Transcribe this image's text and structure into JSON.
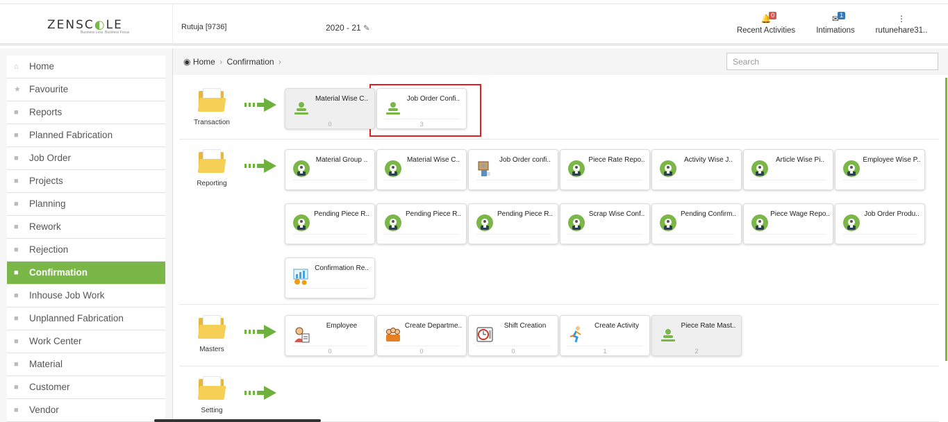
{
  "header": {
    "logo_left": "ZENSC",
    "logo_mid": "◐",
    "logo_right": "LE",
    "tagline": "Business Less. Business Focus",
    "user": "Rutuja [9736]",
    "year": "2020 - 21",
    "edit_icon": "edit-icon",
    "recent": {
      "label": "Recent Activities",
      "icon": "bell-icon",
      "count": "0",
      "color": "#d9534f"
    },
    "intimations": {
      "label": "Intimations",
      "icon": "envelope-icon",
      "count": "1",
      "color": "#337ab7"
    },
    "profile": {
      "label": "rutunehare31..",
      "icon": "more-vertical-icon"
    }
  },
  "sidebar": {
    "active_color": "#7ab648",
    "items": [
      {
        "label": "Home",
        "icon": "home-icon"
      },
      {
        "label": "Favourite",
        "icon": "star-icon"
      },
      {
        "label": "Reports",
        "icon": "file-icon"
      },
      {
        "label": "Planned Fabrication",
        "icon": "file-icon"
      },
      {
        "label": "Job Order",
        "icon": "file-icon"
      },
      {
        "label": "Projects",
        "icon": "file-icon"
      },
      {
        "label": "Planning",
        "icon": "file-icon"
      },
      {
        "label": "Rework",
        "icon": "file-icon"
      },
      {
        "label": "Rejection",
        "icon": "file-icon"
      },
      {
        "label": "Confirmation",
        "icon": "folder-icon",
        "active": true
      },
      {
        "label": "Inhouse Job Work",
        "icon": "file-icon"
      },
      {
        "label": "Unplanned Fabrication",
        "icon": "file-icon"
      },
      {
        "label": "Work Center",
        "icon": "file-icon"
      },
      {
        "label": "Material",
        "icon": "file-icon"
      },
      {
        "label": "Customer",
        "icon": "file-icon"
      },
      {
        "label": "Vendor",
        "icon": "file-icon"
      }
    ]
  },
  "breadcrumb": {
    "icon": "dashboard-icon",
    "home": "Home",
    "current": "Confirmation"
  },
  "search": {
    "placeholder": "Search"
  },
  "sections": [
    {
      "label": "Transaction",
      "tiles": [
        {
          "title": "Material Wise C..",
          "count": "0",
          "icon": "person-icon",
          "grey": true
        },
        {
          "title": "Job Order Confi..",
          "count": "3",
          "icon": "person-icon",
          "highlight": true
        }
      ]
    },
    {
      "label": "Reporting",
      "tiles": [
        {
          "title": "Material Group ..",
          "icon": "report-person-icon"
        },
        {
          "title": "Material Wise C..",
          "icon": "report-person-icon"
        },
        {
          "title": "Job Order confi..",
          "icon": "package-icon"
        },
        {
          "title": "Piece Rate Repo..",
          "icon": "report-person-icon"
        },
        {
          "title": "Activity Wise J..",
          "icon": "report-person-icon"
        },
        {
          "title": "Article Wise Pi..",
          "icon": "report-person-icon"
        },
        {
          "title": "Employee Wise P..",
          "icon": "report-person-icon"
        },
        {
          "title": "Pending Piece R..",
          "icon": "report-person-icon"
        },
        {
          "title": "Pending Piece R..",
          "icon": "report-person-icon"
        },
        {
          "title": "Pending Piece R..",
          "icon": "report-person-icon"
        },
        {
          "title": "Scrap Wise Conf..",
          "icon": "report-person-icon"
        },
        {
          "title": "Pending Confirm..",
          "icon": "report-person-icon"
        },
        {
          "title": "Piece Wage Repo..",
          "icon": "report-person-icon"
        },
        {
          "title": "Job Order Produ..",
          "icon": "report-person-icon"
        },
        {
          "title": "Confirmation Re..",
          "icon": "chart-gear-icon"
        }
      ]
    },
    {
      "label": "Masters",
      "tiles": [
        {
          "title": "Employee",
          "count": "0",
          "icon": "employee-icon"
        },
        {
          "title": "Create Departme..",
          "count": "0",
          "icon": "team-icon"
        },
        {
          "title": "Shift Creation",
          "count": "0",
          "icon": "clock-icon"
        },
        {
          "title": "Create Activity",
          "count": "1",
          "icon": "runner-icon"
        },
        {
          "title": "Piece Rate Mast..",
          "count": "2",
          "icon": "person-icon",
          "grey": true
        }
      ]
    },
    {
      "label": "Setting",
      "tiles": []
    }
  ]
}
